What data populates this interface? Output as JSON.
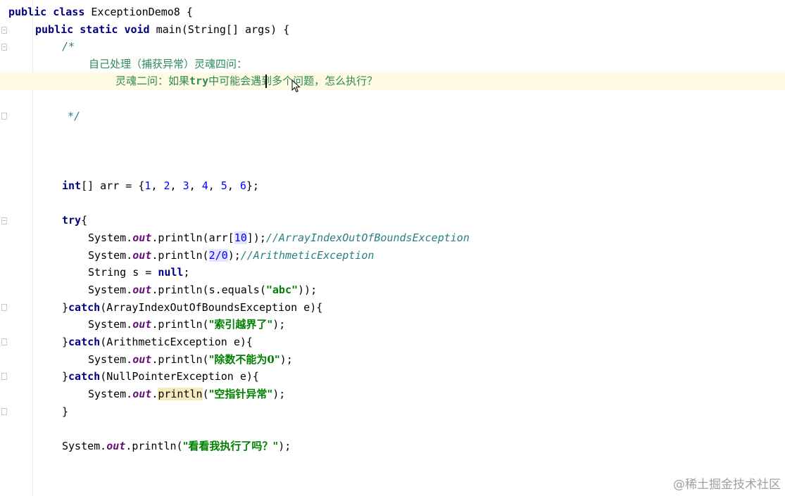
{
  "editor": {
    "lines": {
      "class_kw1": "public",
      "class_kw2": "class",
      "class_name": " ExceptionDemo8 {",
      "main_kw1": "public",
      "main_kw2": "static",
      "main_kw3": "void",
      "main_sig": " main(String[] args) {",
      "comment_open": "/*",
      "comment_line1": "自己处理（捕获异常）灵魂四问：",
      "comment_line2_a": "灵魂二问：如果",
      "comment_line2_b": "try",
      "comment_line2_c": "中可能会遇到多个问题，怎么执行？",
      "comment_close": "*/",
      "arr_kw": "int",
      "arr_decl": "[] arr = {",
      "arr_values": [
        "1",
        "2",
        "3",
        "4",
        "5",
        "6"
      ],
      "arr_end": "};",
      "try_kw": "try",
      "try_brace": "{",
      "p1_pre": "System.",
      "p1_out": "out",
      "p1_mid": ".println(arr[",
      "p1_idx": "10",
      "p1_end": "]);",
      "p1_comment": "//ArrayIndexOutOfBoundsException",
      "p2_pre": "System.",
      "p2_out": "out",
      "p2_mid": ".println(",
      "p2_expr": "2/0",
      "p2_end": ");",
      "p2_comment": "//ArithmeticException",
      "s_decl": "String s = ",
      "s_null": "null",
      "s_end": ";",
      "p3_pre": "System.",
      "p3_out": "out",
      "p3_mid": ".println(s.equals(",
      "p3_str": "\"abc\"",
      "p3_end": "));",
      "c1_brace": "}",
      "c1_kw": "catch",
      "c1_rest": "(ArrayIndexOutOfBoundsException e){",
      "p4_pre": "System.",
      "p4_out": "out",
      "p4_mid": ".println(",
      "p4_str": "\"索引越界了\"",
      "p4_end": ");",
      "c2_brace": "}",
      "c2_kw": "catch",
      "c2_rest": "(ArithmeticException e){",
      "p5_pre": "System.",
      "p5_out": "out",
      "p5_mid": ".println(",
      "p5_str": "\"除数不能为0\"",
      "p5_end": ");",
      "c3_brace": "}",
      "c3_kw": "catch",
      "c3_rest": "(NullPointerException e){",
      "p6_pre": "System.",
      "p6_out": "out",
      "p6_dot": ".",
      "p6_method": "println",
      "p6_open": "(",
      "p6_str": "\"空指针异常\"",
      "p6_end": ");",
      "close_brace": "}",
      "p7_pre": "System.",
      "p7_out": "out",
      "p7_mid": ".println(",
      "p7_str": "\"看看我执行了吗？\"",
      "p7_end": ");"
    }
  },
  "watermark": "@稀土掘金技术社区",
  "colors": {
    "keyword": "#000080",
    "number": "#0000ff",
    "string": "#008000",
    "field": "#660e7a",
    "comment_green": "#2a7f7f",
    "caret_row": "#fffae3"
  },
  "icons": {
    "fold": "fold-marker-icon",
    "cursor": "mouse-pointer-icon"
  }
}
